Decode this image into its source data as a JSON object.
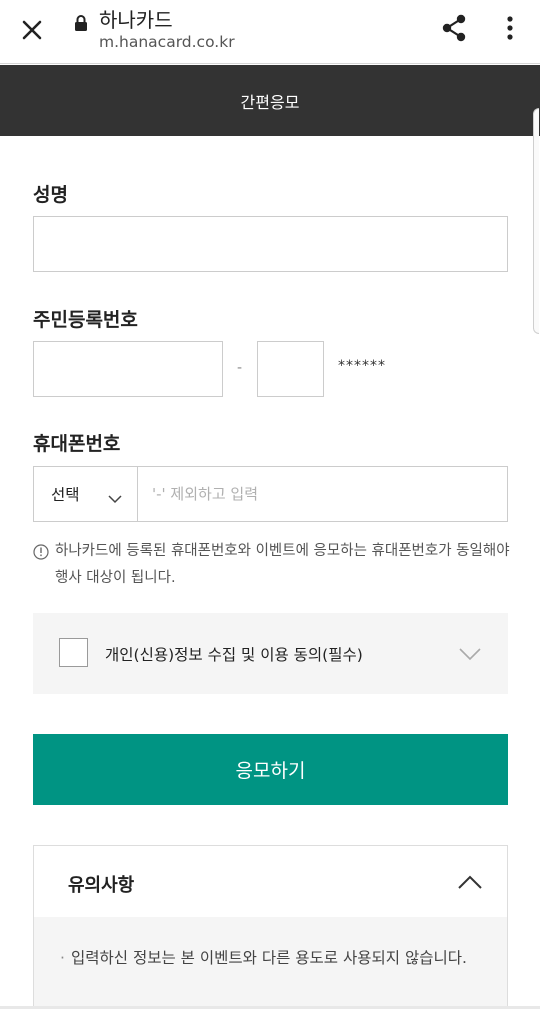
{
  "browser": {
    "site_title": "하나카드",
    "site_url": "m.hanacard.co.kr"
  },
  "header": {
    "title": "간편응모"
  },
  "form": {
    "name_label": "성명",
    "name_value": "",
    "rrn_label": "주민등록번호",
    "rrn_front_value": "",
    "rrn_dash": "-",
    "rrn_back_value": "",
    "rrn_masked": "******",
    "phone_label": "휴대폰번호",
    "phone_select_value": "선택",
    "phone_placeholder": "'-' 제외하고 입력",
    "phone_value": "",
    "notice_text": "하나카드에 등록된 휴대폰번호와 이벤트에 응모하는 휴대폰번호가 동일해야 행사 대상이 됩니다.",
    "agree_label": "개인(신용)정보 수집 및 이용 동의(필수)",
    "agree_checked": false,
    "submit_label": "응모하기"
  },
  "caution": {
    "title": "유의사항",
    "items": [
      "입력하신 정보는 본 이벤트와 다른 용도로 사용되지 않습니다."
    ]
  },
  "colors": {
    "header_bg": "#333333",
    "accent": "#009483",
    "panel_bg": "#f5f5f5"
  },
  "icons": [
    "close-icon",
    "lock-icon",
    "share-icon",
    "more-vertical-icon",
    "chevron-down-icon",
    "info-circle-icon",
    "chevron-up-icon"
  ]
}
